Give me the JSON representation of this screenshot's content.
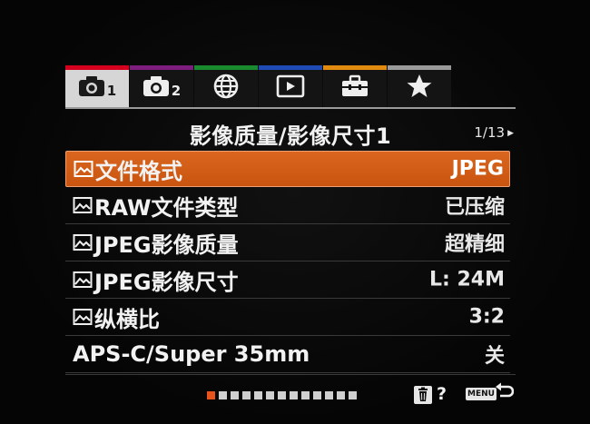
{
  "tabs": [
    {
      "icon": "camera-icon",
      "num": "1",
      "color": "#d4001e",
      "active": true
    },
    {
      "icon": "camera-icon",
      "num": "2",
      "color": "#7d1e7f",
      "active": false
    },
    {
      "icon": "globe-icon",
      "num": "",
      "color": "#1a8a2e",
      "active": false
    },
    {
      "icon": "playback-icon",
      "num": "",
      "color": "#1e4bb5",
      "active": false
    },
    {
      "icon": "toolbox-icon",
      "num": "",
      "color": "#e08a10",
      "active": false
    },
    {
      "icon": "star-icon",
      "num": "",
      "color": "#9a9a9a",
      "active": false
    }
  ],
  "header": {
    "title": "影像质量/影像尺寸1",
    "page": "1/13"
  },
  "rows": [
    {
      "label": "文件格式",
      "value": "JPEG",
      "icon": "image-icon",
      "selected": true
    },
    {
      "label": "RAW文件类型",
      "value": "已压缩",
      "icon": "image-icon",
      "selected": false
    },
    {
      "label": "JPEG影像质量",
      "value": "超精细",
      "icon": "image-icon",
      "selected": false
    },
    {
      "label": "JPEG影像尺寸",
      "value": "L: 24M",
      "icon": "image-icon",
      "selected": false
    },
    {
      "label": "纵横比",
      "value": "3:2",
      "icon": "image-icon",
      "selected": false
    },
    {
      "label": "APS-C/Super 35mm",
      "value": "关",
      "icon": "",
      "selected": false
    }
  ],
  "footer": {
    "page_dots": 13,
    "active_dot": 1,
    "help": "?",
    "menu_label": "MENU"
  },
  "colors": {
    "accent": "#d9661f",
    "dot_active": "#e8521c"
  }
}
